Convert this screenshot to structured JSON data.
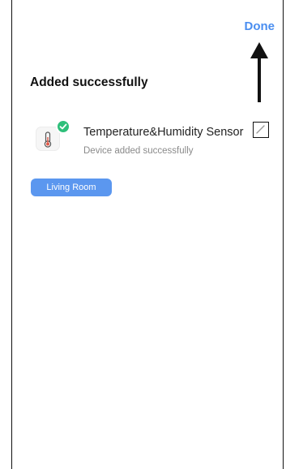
{
  "header": {
    "done_label": "Done"
  },
  "page": {
    "title": "Added successfully"
  },
  "device": {
    "icon": "thermometer-icon",
    "name": "Temperature&Humidity Sensor",
    "status": "Device added successfully",
    "badge_icon": "check-icon",
    "edit_icon": "pencil-icon"
  },
  "room": {
    "label": "Living Room"
  },
  "colors": {
    "accent": "#4a8ef0",
    "room_chip": "#5b97ef",
    "success": "#2ebf7a"
  }
}
